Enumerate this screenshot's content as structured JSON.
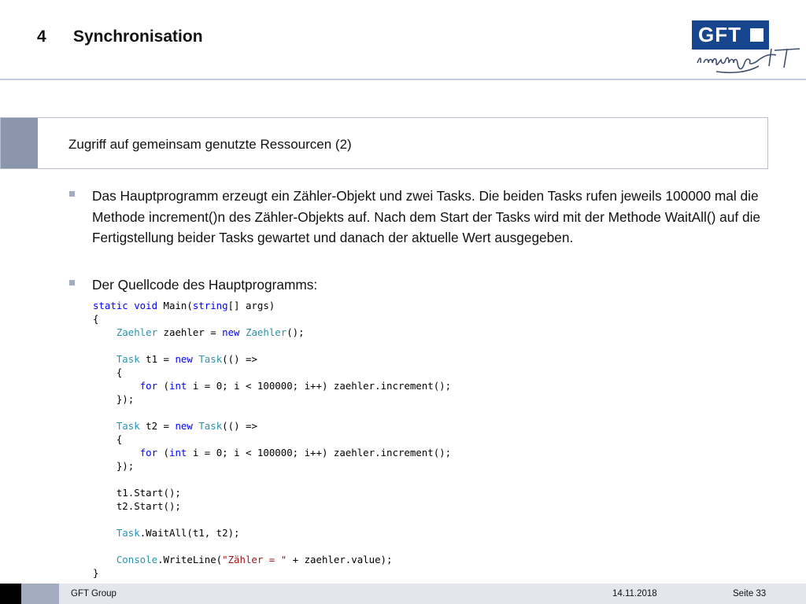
{
  "header": {
    "number": "4",
    "title": "Synchronisation",
    "logo": {
      "text": "GFT",
      "tagline": "inspiring IT",
      "color": "#17468f"
    }
  },
  "subtitle": "Zugriff auf gemeinsam genutzte Ressourcen (2)",
  "bullets": [
    "Das Hauptprogramm erzeugt ein Zähler-Objekt und zwei Tasks. Die beiden Tasks rufen jeweils 100000 mal die Methode increment()n des Zähler-Objekts auf. Nach dem Start der Tasks wird mit der Methode WaitAll() auf die Fertigstellung beider Tasks gewartet und danach der aktuelle Wert ausgegeben.",
    "Der Quellcode des Hauptprogramms:"
  ],
  "code_lines": [
    [
      {
        "t": "static void",
        "c": "kw"
      },
      {
        "t": " Main("
      },
      {
        "t": "string",
        "c": "kw"
      },
      {
        "t": "[] args)"
      }
    ],
    [
      {
        "t": "{"
      }
    ],
    [
      {
        "t": "    "
      },
      {
        "t": "Zaehler",
        "c": "ty"
      },
      {
        "t": " zaehler = "
      },
      {
        "t": "new",
        "c": "kw"
      },
      {
        "t": " "
      },
      {
        "t": "Zaehler",
        "c": "ty"
      },
      {
        "t": "();"
      }
    ],
    [
      {
        "t": ""
      }
    ],
    [
      {
        "t": "    "
      },
      {
        "t": "Task",
        "c": "ty"
      },
      {
        "t": " t1 = "
      },
      {
        "t": "new",
        "c": "kw"
      },
      {
        "t": " "
      },
      {
        "t": "Task",
        "c": "ty"
      },
      {
        "t": "(() =>"
      }
    ],
    [
      {
        "t": "    {"
      }
    ],
    [
      {
        "t": "        "
      },
      {
        "t": "for",
        "c": "kw"
      },
      {
        "t": " ("
      },
      {
        "t": "int",
        "c": "kw"
      },
      {
        "t": " i = 0; i < 100000; i++) zaehler.increment();"
      }
    ],
    [
      {
        "t": "    });"
      }
    ],
    [
      {
        "t": ""
      }
    ],
    [
      {
        "t": "    "
      },
      {
        "t": "Task",
        "c": "ty"
      },
      {
        "t": " t2 = "
      },
      {
        "t": "new",
        "c": "kw"
      },
      {
        "t": " "
      },
      {
        "t": "Task",
        "c": "ty"
      },
      {
        "t": "(() =>"
      }
    ],
    [
      {
        "t": "    {"
      }
    ],
    [
      {
        "t": "        "
      },
      {
        "t": "for",
        "c": "kw"
      },
      {
        "t": " ("
      },
      {
        "t": "int",
        "c": "kw"
      },
      {
        "t": " i = 0; i < 100000; i++) zaehler.increment();"
      }
    ],
    [
      {
        "t": "    });"
      }
    ],
    [
      {
        "t": ""
      }
    ],
    [
      {
        "t": "    t1.Start();"
      }
    ],
    [
      {
        "t": "    t2.Start();"
      }
    ],
    [
      {
        "t": ""
      }
    ],
    [
      {
        "t": "    "
      },
      {
        "t": "Task",
        "c": "ty"
      },
      {
        "t": ".WaitAll(t1, t2);"
      }
    ],
    [
      {
        "t": ""
      }
    ],
    [
      {
        "t": "    "
      },
      {
        "t": "Console",
        "c": "ty"
      },
      {
        "t": ".WriteLine("
      },
      {
        "t": "\"Zähler = \"",
        "c": "st"
      },
      {
        "t": " + zaehler.value);"
      }
    ],
    [
      {
        "t": "}"
      }
    ]
  ],
  "footer": {
    "company": "GFT Group",
    "date": "14.11.2018",
    "page": "Seite 33"
  }
}
